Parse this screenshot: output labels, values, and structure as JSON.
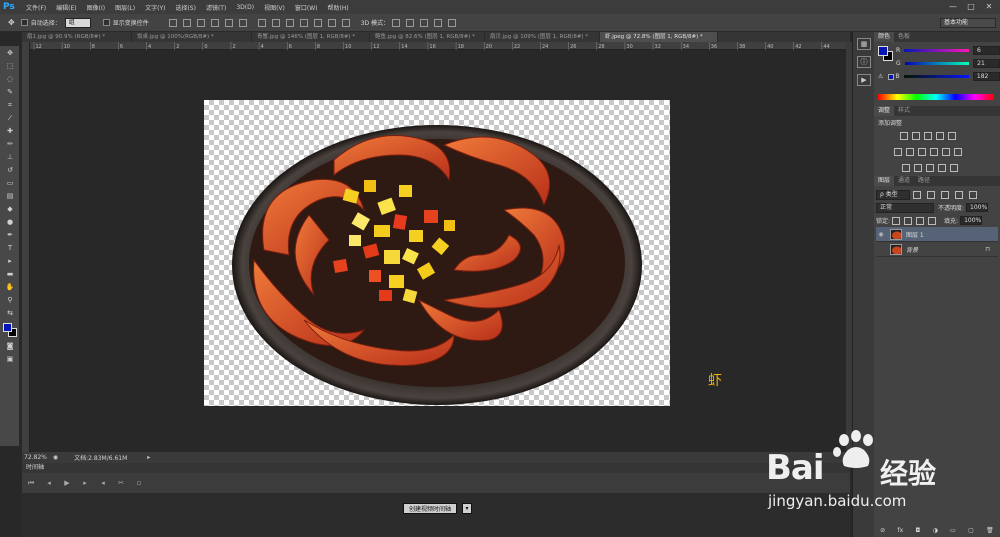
{
  "app": {
    "logo": "Ps"
  },
  "menu": [
    "文件(F)",
    "编辑(E)",
    "图像(I)",
    "图层(L)",
    "文字(Y)",
    "选择(S)",
    "滤镜(T)",
    "3D(D)",
    "视图(V)",
    "窗口(W)",
    "帮助(H)"
  ],
  "window_controls": [
    "—",
    "□",
    "✕"
  ],
  "options": {
    "auto_select_label": "自动选择：",
    "auto_select_value": "组",
    "show_transform_label": "显示变换控件",
    "mode_3d_label": "3D 模式：",
    "workspace": "基本功能"
  },
  "tabs": [
    {
      "label": "扇1.jpg @ 90.9% (RGB/8#) *",
      "active": false
    },
    {
      "label": "饭桌.jpg @ 100%(RGB/8#) *",
      "active": false
    },
    {
      "label": "青蟹.jpg @ 146% (图层 1, RGB/8#) *",
      "active": false
    },
    {
      "label": "鲍鱼.jpg @ 82.6% (图层 1, RGB/8#) *",
      "active": false
    },
    {
      "label": "扇贝.jpg @ 109% (图层 1, RGB/8#) *",
      "active": false
    },
    {
      "label": "虾.jpeg @ 72.8% (图层 1, RGB/8#) *",
      "active": true
    }
  ],
  "ruler_ticks": [
    "12",
    "10",
    "8",
    "6",
    "4",
    "2",
    "0",
    "2",
    "4",
    "6",
    "8",
    "10",
    "12",
    "14",
    "16",
    "18",
    "20",
    "22",
    "24",
    "26",
    "28",
    "30",
    "32",
    "34",
    "36",
    "38",
    "40",
    "42",
    "44"
  ],
  "canvas_label": "虾",
  "status": {
    "zoom": "72.82%",
    "doc": "文档:2.83M/6.61M"
  },
  "timeline": {
    "title": "时间轴",
    "create_button": "创建视频时间轴",
    "dropdown_arrow": "▾"
  },
  "color_panel": {
    "tabs": [
      "颜色",
      "色板"
    ],
    "channels": [
      {
        "label": "R",
        "value": "6"
      },
      {
        "label": "G",
        "value": "21"
      },
      {
        "label": "B",
        "value": "182"
      }
    ],
    "foreground": "#0615b6",
    "background": "#000000"
  },
  "adjustments_panel": {
    "tabs": [
      "调整",
      "样式"
    ],
    "title": "添加调整"
  },
  "layers_panel": {
    "tabs": [
      "图层",
      "通道",
      "路径"
    ],
    "filter_kind": "ρ 类型",
    "blend_mode": "正常",
    "opacity_label": "不透明度:",
    "opacity_value": "100%",
    "lock_label": "锁定:",
    "fill_label": "填充:",
    "fill_value": "100%",
    "layers": [
      {
        "name": "图层 1",
        "selected": true,
        "visible": true
      },
      {
        "name": "背景",
        "selected": false,
        "visible": false
      }
    ]
  },
  "watermark": {
    "brand_left": "Bai",
    "brand_right": "经验",
    "url": "jingyan.baidu.com"
  }
}
